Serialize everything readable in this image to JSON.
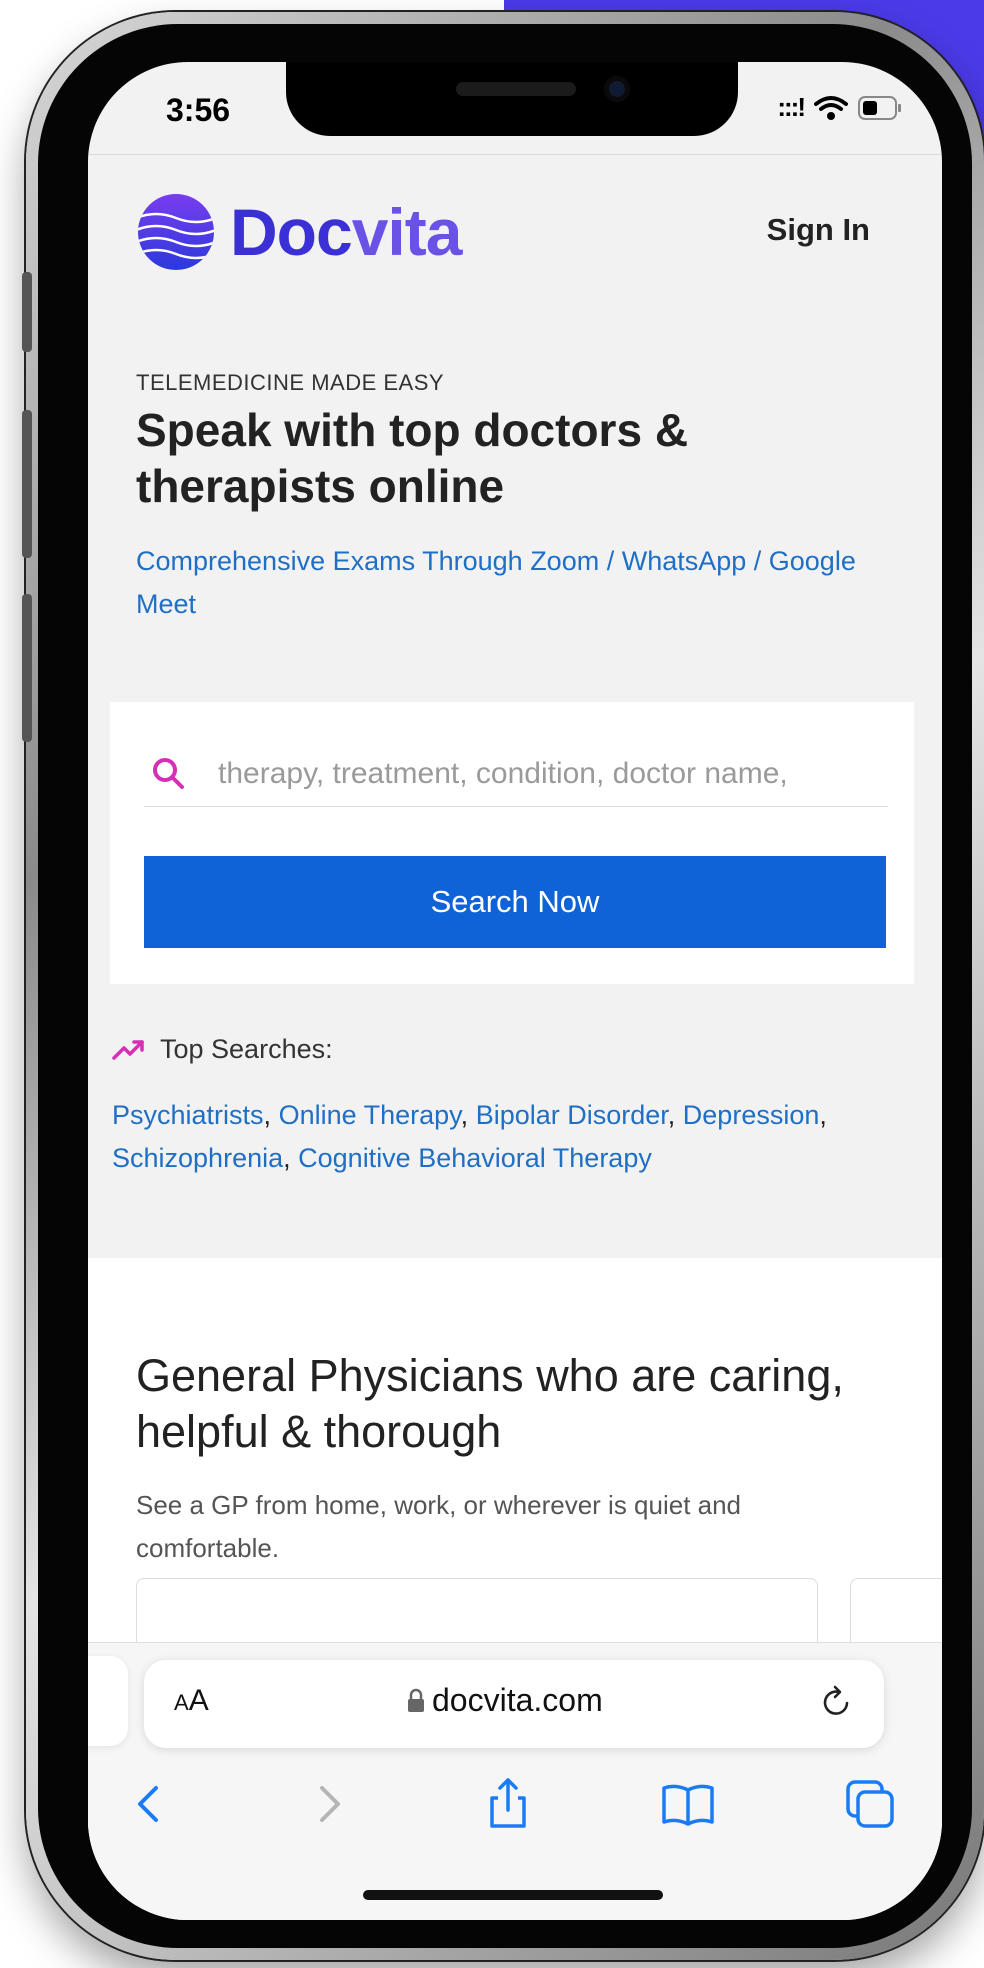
{
  "status_bar": {
    "time": "3:56",
    "signal": ":::!"
  },
  "header": {
    "logo_part1": "Doc",
    "logo_part2": "vita",
    "signin": "Sign In"
  },
  "hero": {
    "eyebrow": "TELEMEDICINE MADE EASY",
    "title": "Speak with top doctors & therapists online",
    "subtitle": "Comprehensive Exams Through Zoom / WhatsApp / Google Meet"
  },
  "search": {
    "placeholder": "therapy, treatment, condition, doctor name,",
    "button": "Search Now"
  },
  "top_searches": {
    "label": "Top Searches:",
    "items": [
      "Psychiatrists",
      "Online Therapy",
      "Bipolar Disorder",
      "Depression",
      "Schizophrenia",
      "Cognitive Behavioral Therapy"
    ]
  },
  "gp_section": {
    "title": "General Physicians who are caring, helpful & thorough",
    "description": "See a GP from home, work, or wherever is quiet and comfortable."
  },
  "browser": {
    "text_size_label_small": "A",
    "text_size_label_large": "A",
    "url": "docvita.com"
  },
  "colors": {
    "brand": "#3b2fd6",
    "link": "#1f6fc5",
    "button": "#0f63d6",
    "accent": "#d62fb6"
  }
}
